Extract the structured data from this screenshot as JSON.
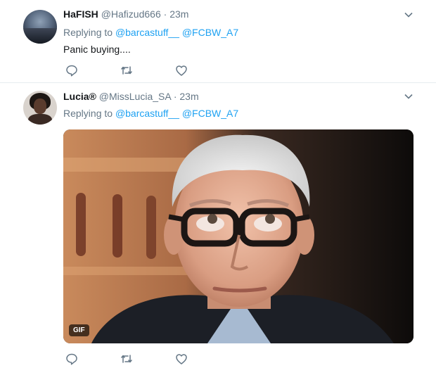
{
  "tweets": [
    {
      "name": "HaFISH",
      "handle": "@Hafizud666",
      "dot": "·",
      "time": "23m",
      "replying_prefix": "Replying to",
      "mention1": "@barcastuff__",
      "mention2": "@FCBW_A7",
      "text": "Panic buying...."
    },
    {
      "name": "Lucia®",
      "handle": "@MissLucia_SA",
      "dot": "·",
      "time": "23m",
      "replying_prefix": "Replying to",
      "mention1": "@barcastuff__",
      "mention2": "@FCBW_A7",
      "media_badge": "GIF"
    }
  ],
  "icons": [
    "avatar",
    "chevron-down-icon",
    "reply-icon",
    "retweet-icon",
    "like-icon"
  ],
  "colors": {
    "link": "#1da1f2",
    "muted": "#657786",
    "text": "#14171a",
    "divider": "#e6ecf0"
  }
}
